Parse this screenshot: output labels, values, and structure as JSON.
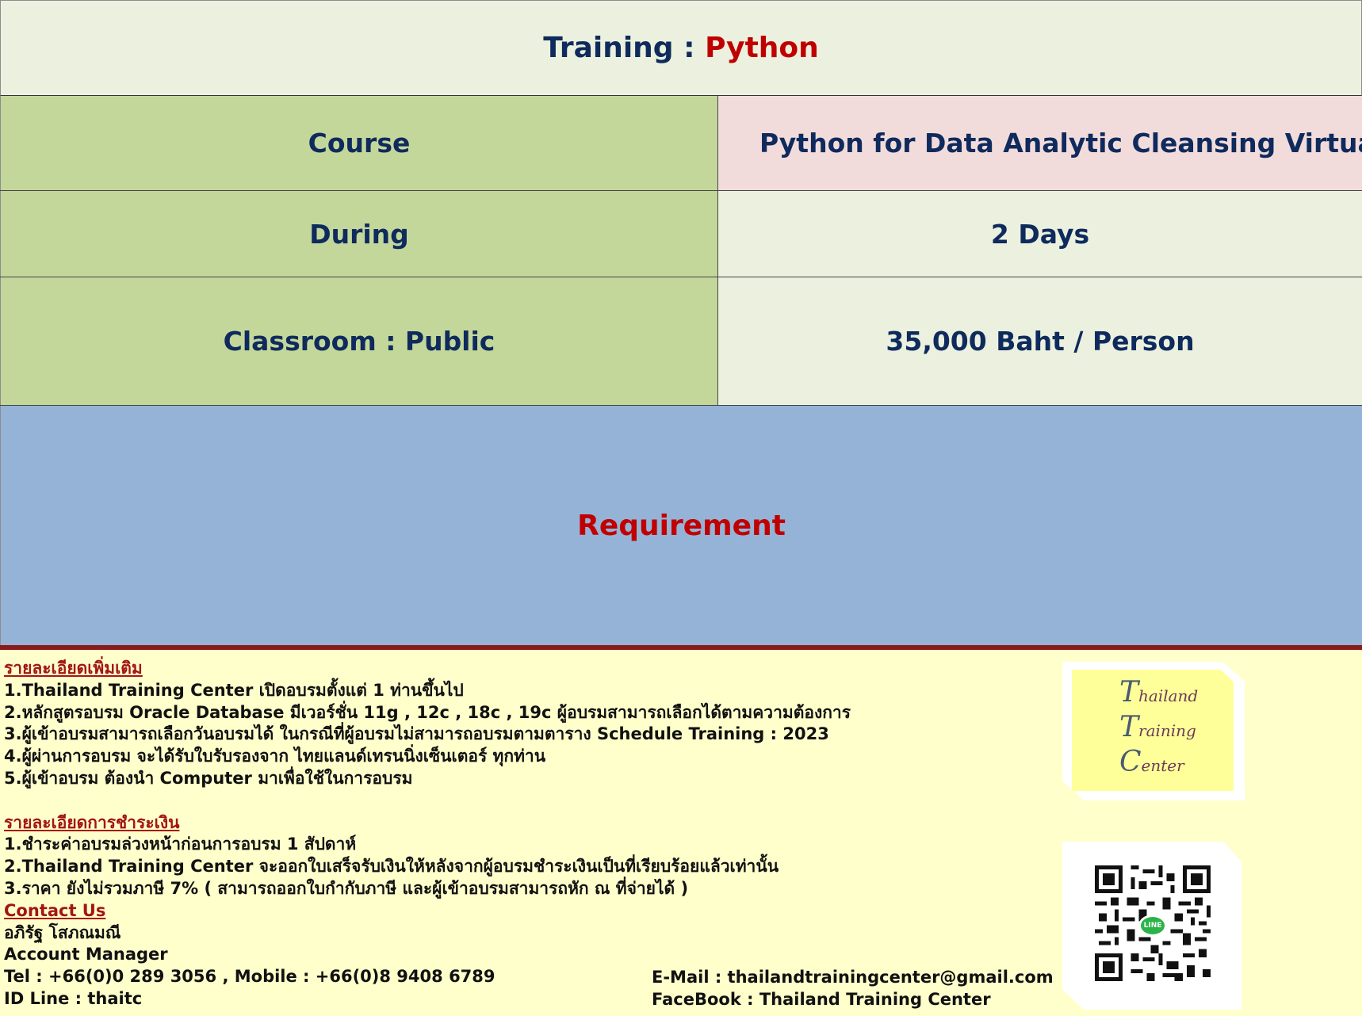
{
  "title": {
    "prefix": "Training : ",
    "subject": "Python"
  },
  "rows": [
    {
      "label": "Course",
      "value": "Python for Data Analytic Cleansing Virtualiza"
    },
    {
      "label": "During",
      "value": "2  Days"
    },
    {
      "label": "Classroom : Public",
      "value": "35,000 Baht / Person"
    }
  ],
  "requirement": {
    "label": "Requirement"
  },
  "details": {
    "heading": "รายละเอียดเพิ่มเติม",
    "items": [
      "1.Thailand Training Center เปิดอบรมตั้งแต่ 1 ท่านขึ้นไป",
      "2.หลักสูตรอบรม Oracle Database มีเวอร์ชั่น 11g , 12c , 18c  , 19c ผู้อบรมสามารถเลือกได้ตามความต้องการ",
      "3.ผู้เข้าอบรมสามารถเลือกวันอบรมได้ ในกรณีที่ผู้อบรมไม่สามารถอบรมตามตาราง Schedule Training : 2023",
      "4.ผู้ผ่านการอบรม จะได้รับใบรับรองจาก ไทยแลนด์เทรนนิ่งเซ็นเตอร์ ทุกท่าน",
      "5.ผู้เข้าอบรม ต้องนำ Computer มาเพื่อใช้ในการอบรม"
    ]
  },
  "payment": {
    "heading": "รายละเอียดการชำระเงิน",
    "items": [
      "1.ชำระค่าอบรมล่วงหน้าก่อนการอบรม 1 สัปดาห์",
      "2.Thailand Training Center จะออกใบเสร็จรับเงินให้หลังจากผู้อบรมชำระเงินเป็นที่เรียบร้อยแล้วเท่านั้น",
      "3.ราคา ยังไม่รวมภาษี 7% ( สามารถออกใบกำกับภาษี และผู้เข้าอบรมสามารถหัก ณ ที่จ่ายได้ )"
    ]
  },
  "contact": {
    "heading": "Contact Us",
    "name": "อภิรัฐ  โสภณมณี",
    "role": "Account  Manager",
    "tel": "Tel : +66(0)0 289 3056 , Mobile  : +66(0)8 9408 6789",
    "line_id": "ID Line  : thaitc",
    "email": "E-Mail  : thailandtrainingcenter@gmail.com",
    "facebook": "FaceBook : Thailand Training Center"
  },
  "logo": {
    "words": [
      {
        "cap": "T",
        "rest": "hailand"
      },
      {
        "cap": "T",
        "rest": "raining"
      },
      {
        "cap": "C",
        "rest": "enter"
      }
    ]
  },
  "qr": {
    "badge": "LINE"
  },
  "colors": {
    "navy": "#0f2a5c",
    "red": "#c00000",
    "label_green": "#c4d79b",
    "pale_green": "#ebf1de",
    "pink": "#f2dcdb",
    "blue": "#95b3d7",
    "cream": "#ffffcc"
  }
}
